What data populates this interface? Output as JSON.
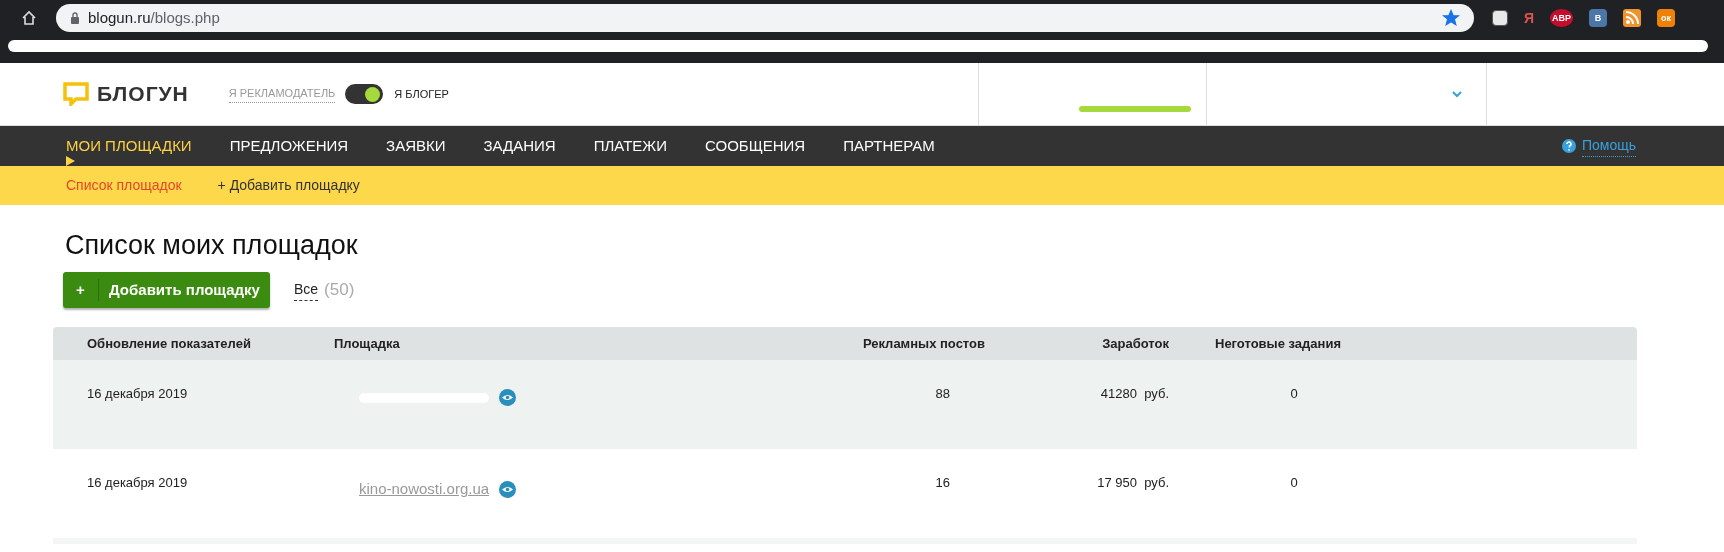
{
  "browser": {
    "url_host": "blogun.ru",
    "url_path": "/blogs.php",
    "bookmarked": true,
    "extensions": [
      {
        "kind": "note"
      },
      {
        "kind": "text",
        "label": "Я",
        "color": "#d9534f"
      },
      {
        "kind": "badge",
        "label": "ABP",
        "color": "#c70d2c"
      },
      {
        "kind": "badge",
        "label": "B",
        "color": "#4a76a8"
      },
      {
        "kind": "rss",
        "color": "#f0932b"
      },
      {
        "kind": "badge",
        "label": "ок",
        "color": "#ee8208"
      }
    ]
  },
  "header": {
    "logo": "БЛОГУН",
    "role_switch": {
      "left_label": "Я РЕКЛАМОДАТЕЛЬ",
      "right_label": "Я БЛОГЕР",
      "on": true
    }
  },
  "nav": {
    "items": [
      {
        "label": "МОИ ПЛОЩАДКИ",
        "selected": true
      },
      {
        "label": "ПРЕДЛОЖЕНИЯ",
        "selected": false
      },
      {
        "label": "ЗАЯВКИ",
        "selected": false
      },
      {
        "label": "ЗАДАНИЯ",
        "selected": false
      },
      {
        "label": "ПЛАТЕЖИ",
        "selected": false
      },
      {
        "label": "СООБЩЕНИЯ",
        "selected": false
      },
      {
        "label": "ПАРТНЕРАМ",
        "selected": false
      }
    ],
    "help": "Помощь"
  },
  "subnav": {
    "items": [
      {
        "label": "Список площадок",
        "selected": true
      },
      {
        "label": "+ Добавить площадку",
        "selected": false
      }
    ]
  },
  "page_title": "Список моих площадок",
  "add_button": {
    "icon": "+",
    "label": "Добавить площадку"
  },
  "filter": {
    "label": "Все",
    "count": "(50)"
  },
  "table": {
    "columns": [
      "Обновление показателей",
      "Площадка",
      "Рекламных постов",
      "Заработок",
      "Неготовые задания"
    ],
    "rows": [
      {
        "updated": "16 декабря 2019",
        "posts": "88",
        "earnings": "41280",
        "currency": "руб.",
        "pending": "0",
        "shaded": true
      },
      {
        "updated": "16 декабря 2019",
        "site": "kino-nowosti.org.ua",
        "posts": "16",
        "earnings": "17 950",
        "currency": "руб.",
        "pending": "0",
        "shaded": false
      }
    ]
  }
}
